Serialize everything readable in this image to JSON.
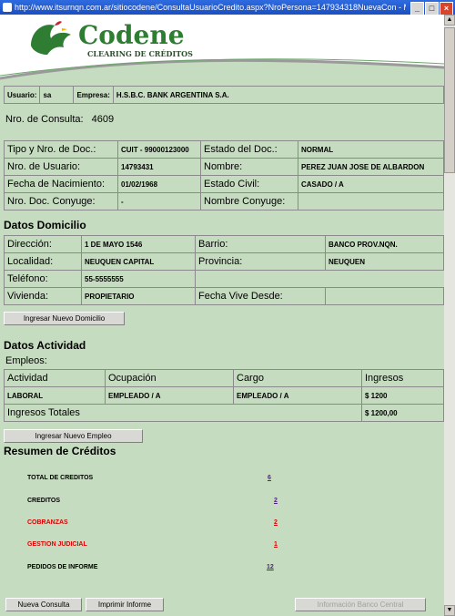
{
  "window": {
    "title": "http://www.itsurnqn.com.ar/sitiocodene/ConsultaUsuarioCredito.aspx?NroPersona=147934318NuevaCon - Microsoft Interne..."
  },
  "banner": {
    "brand": "Codene",
    "subtitle": "CLEARING DE CRÉDITOS"
  },
  "user_bar": {
    "usuario_label": "Usuario:",
    "usuario_value": "sa",
    "empresa_label": "Empresa:",
    "empresa_value": "H.S.B.C. BANK ARGENTINA S.A."
  },
  "consulta": {
    "label": "Nro. de Consulta:",
    "value": "4609"
  },
  "persona": {
    "tipo_doc_label": "Tipo y Nro. de Doc.:",
    "tipo_doc_value": "CUIT - 99000123000",
    "estado_doc_label": "Estado del Doc.:",
    "estado_doc_value": "NORMAL",
    "nro_usuario_label": "Nro. de Usuario:",
    "nro_usuario_value": "14793431",
    "nombre_label": "Nombre:",
    "nombre_value": "PEREZ JUAN JOSE DE ALBARDON",
    "fecha_nac_label": "Fecha de Nacimiento:",
    "fecha_nac_value": "01/02/1968",
    "estado_civil_label": "Estado Civil:",
    "estado_civil_value": "CASADO / A",
    "doc_conyuge_label": "Nro. Doc. Conyuge:",
    "doc_conyuge_value": "-",
    "nombre_conyuge_label": "Nombre Conyuge:",
    "nombre_conyuge_value": ""
  },
  "domicilio": {
    "title": "Datos Domicilio",
    "direccion_label": "Dirección:",
    "direccion_value": "1 DE MAYO 1546",
    "barrio_label": "Barrio:",
    "barrio_value": "BANCO PROV.NQN.",
    "localidad_label": "Localidad:",
    "localidad_value": "NEUQUEN CAPITAL",
    "provincia_label": "Provincia:",
    "provincia_value": "NEUQUEN",
    "telefono_label": "Teléfono:",
    "telefono_value": "55-5555555",
    "vivienda_label": "Vivienda:",
    "vivienda_value": "PROPIETARIO",
    "fecha_vive_label": "Fecha Vive Desde:",
    "fecha_vive_value": "",
    "button": "Ingresar Nuevo Domicilio"
  },
  "actividad": {
    "title": "Datos Actividad",
    "empleos_label": "Empleos:",
    "headers": [
      "Actividad",
      "Ocupación",
      "Cargo",
      "Ingresos"
    ],
    "row": [
      "LABORAL",
      "EMPLEADO / A",
      "EMPLEADO / A",
      "$ 1200"
    ],
    "total_label": "Ingresos Totales",
    "total_value": "$ 1200,00",
    "button": "Ingresar Nuevo Empleo"
  },
  "resumen": {
    "title": "Resumen de Créditos",
    "items": [
      {
        "label": "TOTAL DE CREDITOS",
        "value": "6",
        "color": "#000000"
      },
      {
        "label": "CREDITOS",
        "value": "2",
        "color": "#000000"
      },
      {
        "label": "COBRANZAS",
        "value": "2",
        "color": "#e00000"
      },
      {
        "label": "GESTION JUDICIAL",
        "value": "1",
        "color": "#e00000"
      },
      {
        "label": "PEDIDOS DE INFORME",
        "value": "12",
        "color": "#000000"
      }
    ]
  },
  "footer": {
    "nueva": "Nueva Consulta",
    "imprimir": "Imprimir Informe",
    "banco": "Información Banco Central"
  }
}
